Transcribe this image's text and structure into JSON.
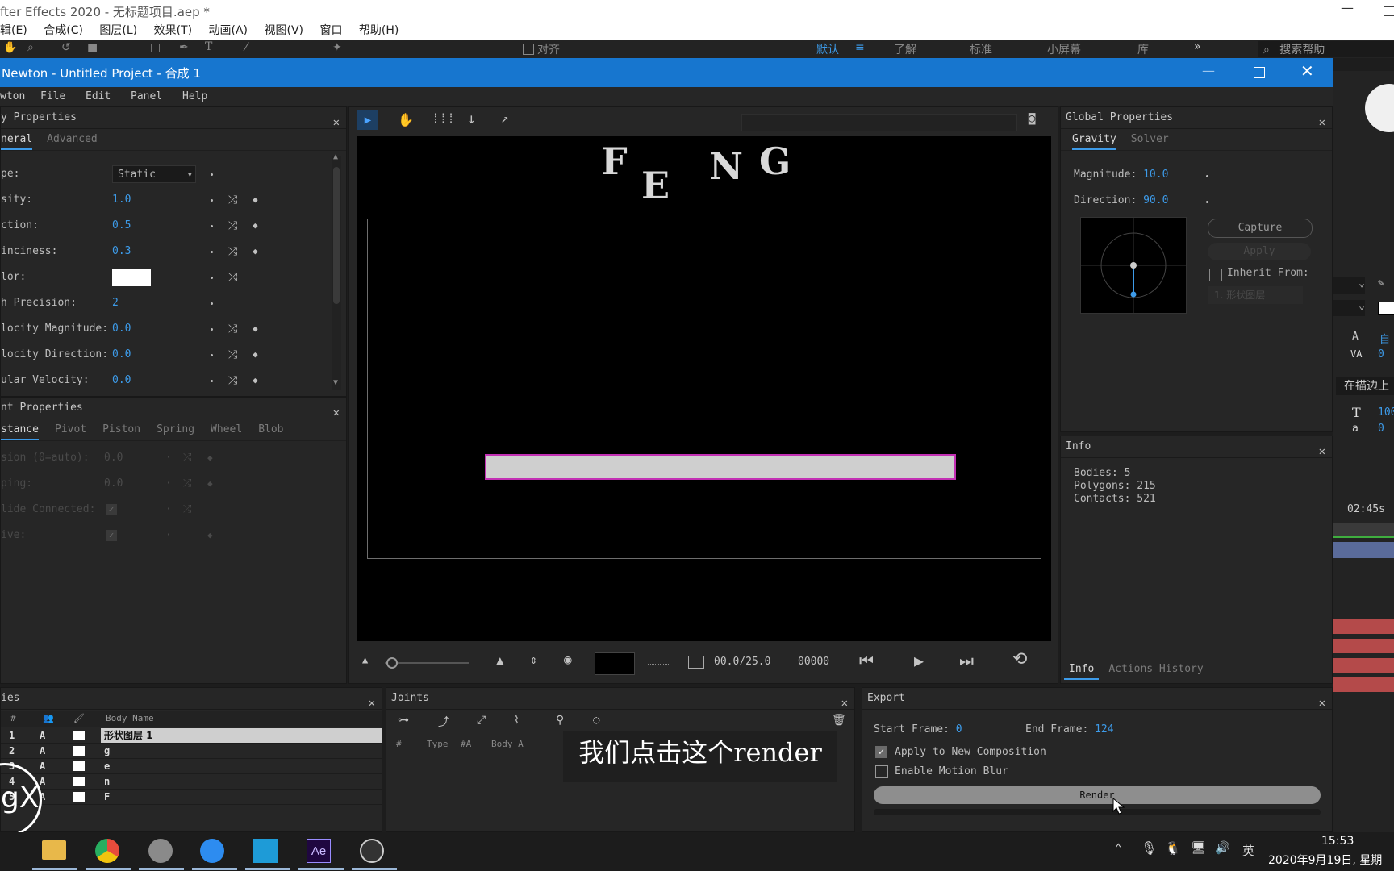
{
  "ae": {
    "title": "fter Effects 2020 - 无标题项目.aep *",
    "menu": [
      "辑(E)",
      "合成(C)",
      "图层(L)",
      "效果(T)",
      "动画(A)",
      "视图(V)",
      "窗口",
      "帮助(H)"
    ],
    "toolbar_snap": "对齐",
    "workspaces": [
      "默认",
      "了解",
      "标准",
      "小屏幕",
      "库"
    ],
    "search_placeholder": "搜索帮助",
    "right_values": {
      "tracking": "0",
      "stroke_opt": "在描边上",
      "size": "100",
      "baseline": "0 "
    },
    "timecode": "02:45s"
  },
  "newton": {
    "title": "Newton - Untitled Project - 合成 1",
    "menu": [
      "wton",
      "File",
      "Edit",
      "Panel",
      "Help"
    ],
    "body_props": {
      "title": "y Properties",
      "tabs": [
        "neral",
        "Advanced"
      ],
      "rows": [
        {
          "label": "pe:",
          "value": "Static"
        },
        {
          "label": "sity:",
          "value": "1.0"
        },
        {
          "label": "ction:",
          "value": "0.5"
        },
        {
          "label": "inciness:",
          "value": "0.3"
        },
        {
          "label": "lor:",
          "value": ""
        },
        {
          "label": "h Precision:",
          "value": "2"
        },
        {
          "label": "locity Magnitude:",
          "value": "0.0"
        },
        {
          "label": "locity Direction:",
          "value": "0.0"
        },
        {
          "label": "ular Velocity:",
          "value": "0.0"
        }
      ]
    },
    "joint_props": {
      "title": "nt Properties",
      "tabs": [
        "stance",
        "Pivot",
        "Piston",
        "Spring",
        "Wheel",
        "Blob"
      ],
      "rows": [
        {
          "label": "sion (0=auto):",
          "value": "0.0"
        },
        {
          "label": "ping:",
          "value": "0.0"
        },
        {
          "label": "lide Connected:",
          "value": ""
        },
        {
          "label": "ive:",
          "value": ""
        }
      ]
    },
    "viewport": {
      "letters": [
        "F",
        "E",
        "N",
        "G"
      ],
      "frame": "00.0/25.0",
      "frame_num": "00000"
    },
    "global": {
      "title": "Global Properties",
      "tabs": [
        "Gravity",
        "Solver"
      ],
      "magnitude_label": "Magnitude:",
      "magnitude": "10.0",
      "direction_label": "Direction:",
      "direction": "90.0",
      "capture": "Capture",
      "apply": "Apply",
      "inherit": "Inherit From:",
      "inherit_value": "1. 形状图层"
    },
    "info": {
      "title": "Info",
      "bodies": "Bodies: 5",
      "polygons": "Polygons: 215",
      "contacts": "Contacts: 521",
      "tabs": [
        "Info",
        "Actions History"
      ]
    },
    "bodies": {
      "title": "ies",
      "col_num": "#",
      "col_name": "Body Name",
      "rows": [
        {
          "n": "1",
          "t": "A",
          "name": "形状图层 1"
        },
        {
          "n": "2",
          "t": "A",
          "name": "g"
        },
        {
          "n": "3",
          "t": "A",
          "name": "e"
        },
        {
          "n": "4",
          "t": "A",
          "name": "n"
        },
        {
          "n": "5",
          "t": "A",
          "name": "F"
        }
      ]
    },
    "joints": {
      "title": "Joints",
      "cols": [
        "#",
        "Type",
        "#A",
        "Body A"
      ]
    },
    "export": {
      "title": "Export",
      "start_label": "Start Frame:",
      "start": "0",
      "end_label": "End Frame:",
      "end": "124",
      "apply_new": "Apply to New Composition",
      "motion_blur": "Enable Motion Blur",
      "render": "Render"
    }
  },
  "subtitle": "我们点击这个render",
  "watermark": "gX",
  "taskbar": {
    "time": "15:53",
    "date": "2020年9月19日, 星期",
    "ime": "英",
    "ae_label": "Ae"
  }
}
